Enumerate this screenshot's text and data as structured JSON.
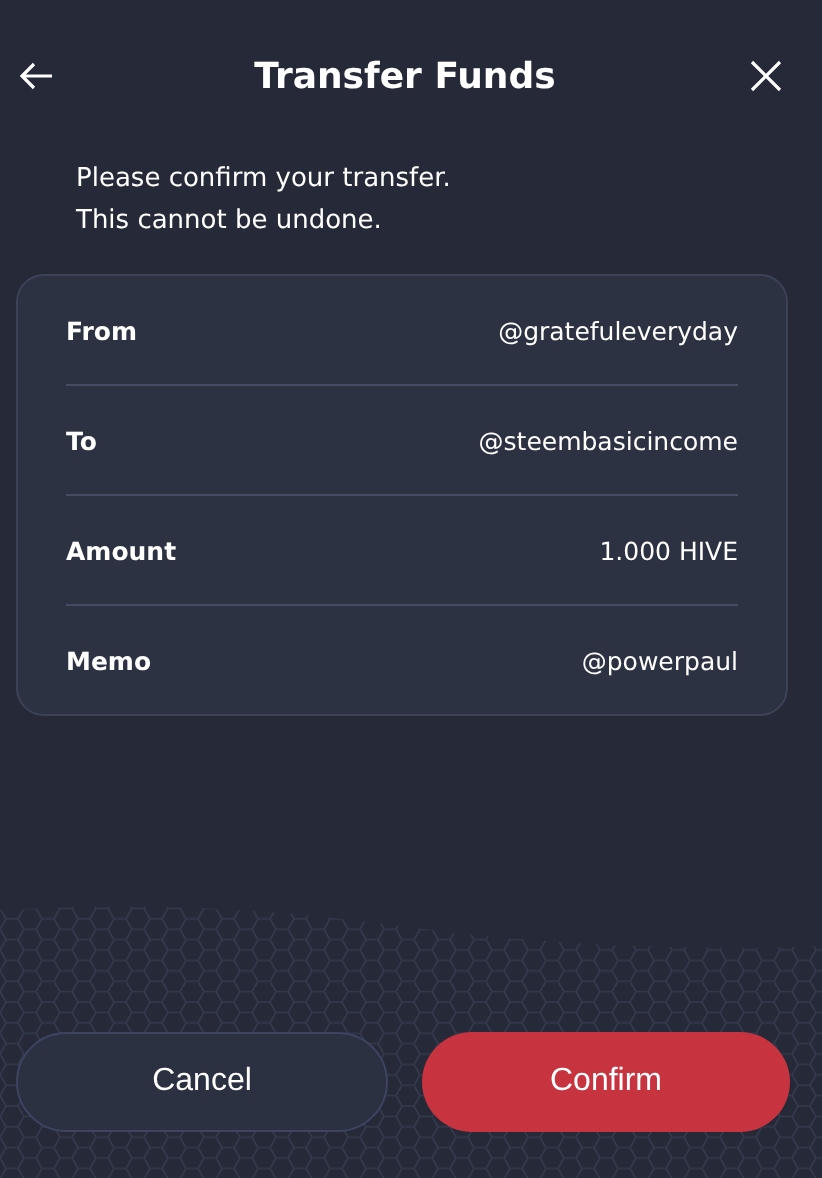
{
  "header": {
    "title": "Transfer Funds"
  },
  "message": [
    "Please confirm your transfer.",
    "This cannot be undone."
  ],
  "details": [
    {
      "label": "From",
      "value": "@gratefuleveryday"
    },
    {
      "label": "To",
      "value": "@steembasicincome"
    },
    {
      "label": "Amount",
      "value": "1.000 HIVE"
    },
    {
      "label": "Memo",
      "value": "@powerpaul"
    }
  ],
  "buttons": [
    {
      "label": "Cancel",
      "kind": "secondary"
    },
    {
      "label": "Confirm",
      "kind": "primary"
    }
  ]
}
